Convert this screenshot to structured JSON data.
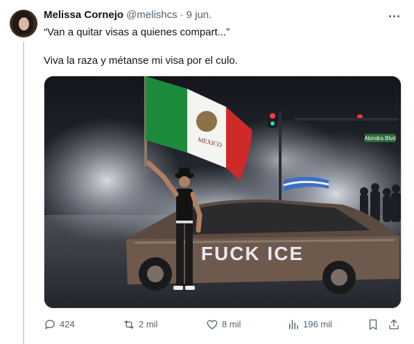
{
  "tweet": {
    "author_name": "Melissa Cornejo",
    "author_handle": "@melishcs",
    "separator": "·",
    "date": "9 jun.",
    "quote_line": "“Van a quitar visas a quienes compart...”",
    "body_line": "Viva la raza y métanse mi visa por el culo.",
    "image": {
      "flag_text": "MEXICO",
      "graffiti_text": "FUCK ICE",
      "street_sign_text": "Alondra Blvd"
    }
  },
  "actions": {
    "replies": "424",
    "reposts": "2 mil",
    "likes": "8 mil",
    "views": "196 mil"
  },
  "colors": {
    "muted_text": "#536471",
    "primary_text": "#0f1419",
    "border": "#cfd9de"
  },
  "icons": [
    "more-icon",
    "reply-icon",
    "repost-icon",
    "like-icon",
    "views-icon",
    "bookmark-icon",
    "share-icon"
  ]
}
